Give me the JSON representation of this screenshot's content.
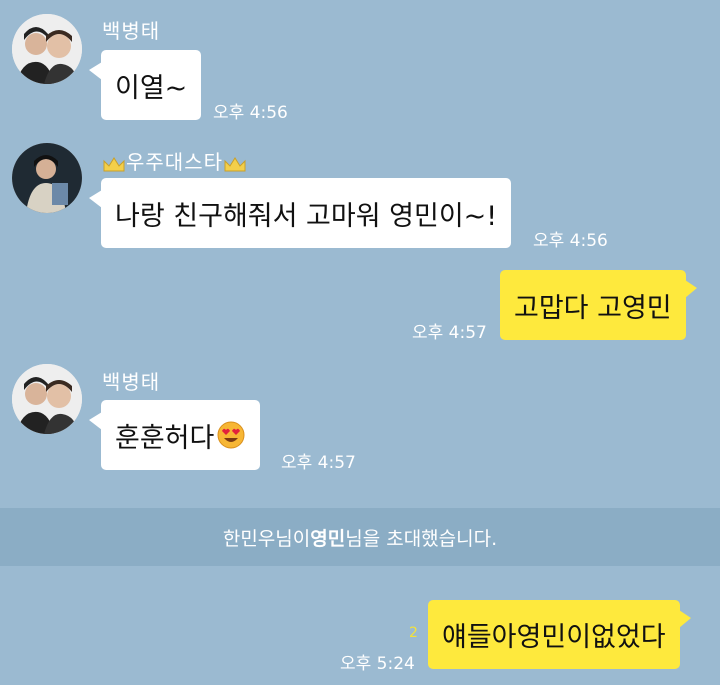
{
  "messages": [
    {
      "sender": "백병태",
      "text": "이열~",
      "time": "오후 4:56"
    },
    {
      "sender": "우주대스타",
      "text": "나랑 친구해줘서 고마워 영민이~!",
      "time": "오후 4:56"
    },
    {
      "text": "고맙다 고영민",
      "time": "오후 4:57"
    },
    {
      "sender": "백병태",
      "text": "훈훈허다",
      "time": "오후 4:57"
    },
    {
      "text": "얘들아영민이없었다",
      "time": "오후 5:24",
      "unread": "2"
    }
  ],
  "system": {
    "pre": "한민우님이 ",
    "name": "영민",
    "post": "님을 초대했습니다."
  },
  "colors": {
    "background": "#9bbad1",
    "my_bubble": "#fee93d",
    "other_bubble": "#ffffff"
  }
}
